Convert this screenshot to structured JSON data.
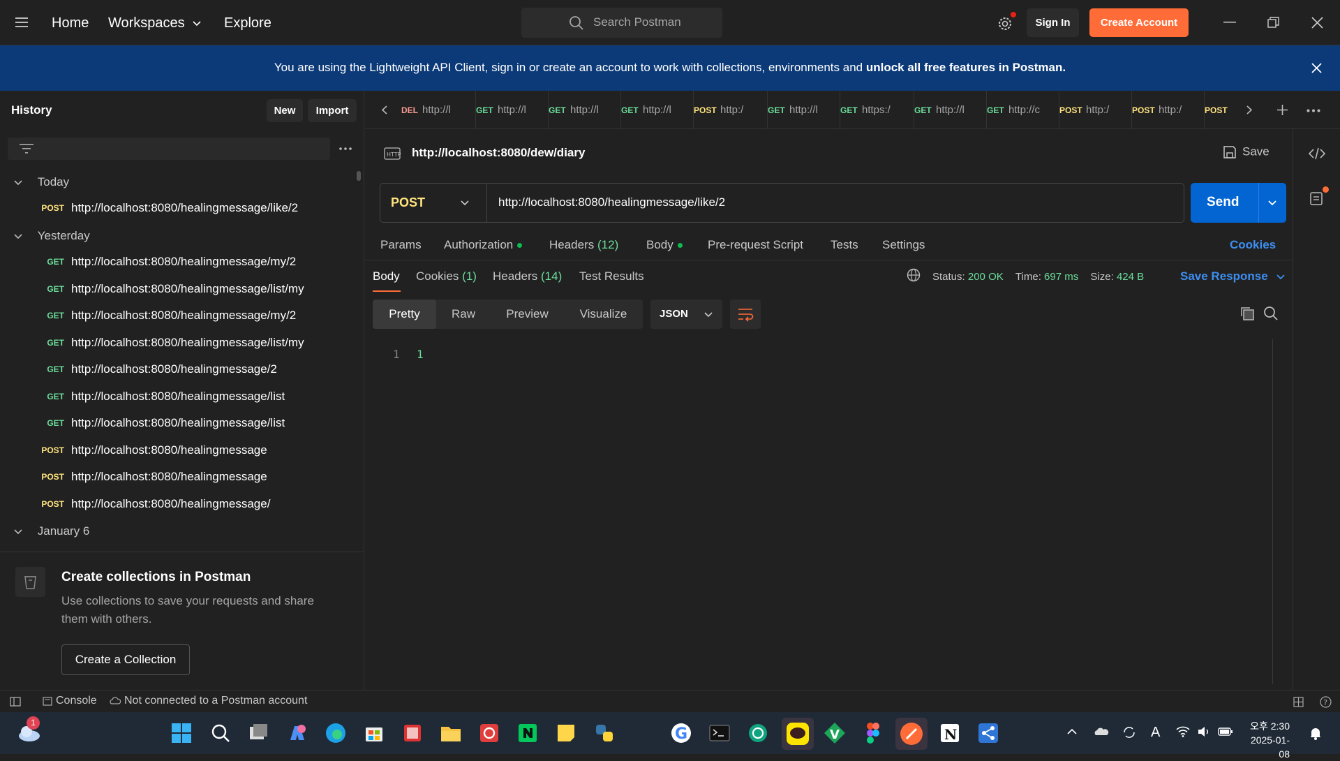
{
  "topbar": {
    "home": "Home",
    "workspaces": "Workspaces",
    "explore": "Explore",
    "search_placeholder": "Search Postman",
    "sign_in": "Sign In",
    "create_account": "Create Account"
  },
  "banner": {
    "text": "You are using the Lightweight API Client, sign in or create an account to work with collections, environments and ",
    "bold": "unlock all free features in Postman."
  },
  "sidebar": {
    "title": "History",
    "new_label": "New",
    "import_label": "Import",
    "groups": [
      {
        "label": "Today"
      },
      {
        "label": "Yesterday"
      },
      {
        "label": "January 6"
      }
    ],
    "items": [
      {
        "method": "POST",
        "url": "http://localhost:8080/healingmessage/like/2"
      },
      {
        "method": "GET",
        "url": "http://localhost:8080/healingmessage/my/2"
      },
      {
        "method": "GET",
        "url": "http://localhost:8080/healingmessage/list/my"
      },
      {
        "method": "GET",
        "url": "http://localhost:8080/healingmessage/my/2"
      },
      {
        "method": "GET",
        "url": "http://localhost:8080/healingmessage/list/my"
      },
      {
        "method": "GET",
        "url": "http://localhost:8080/healingmessage/2"
      },
      {
        "method": "GET",
        "url": "http://localhost:8080/healingmessage/list"
      },
      {
        "method": "GET",
        "url": "http://localhost:8080/healingmessage/list"
      },
      {
        "method": "POST",
        "url": "http://localhost:8080/healingmessage"
      },
      {
        "method": "POST",
        "url": "http://localhost:8080/healingmessage"
      },
      {
        "method": "POST",
        "url": "http://localhost:8080/healingmessage/"
      }
    ],
    "promo_title": "Create collections in Postman",
    "promo_text_1": "Use collections to save your requests and share",
    "promo_text_2": "them with others.",
    "promo_button": "Create a Collection"
  },
  "tabs": [
    {
      "method": "DEL",
      "url": "http://l"
    },
    {
      "method": "GET",
      "url": "http://l"
    },
    {
      "method": "GET",
      "url": "http://l"
    },
    {
      "method": "GET",
      "url": "http://l"
    },
    {
      "method": "POST",
      "url": "http:/"
    },
    {
      "method": "GET",
      "url": "http://l"
    },
    {
      "method": "GET",
      "url": "https:/"
    },
    {
      "method": "GET",
      "url": "http://l"
    },
    {
      "method": "GET",
      "url": "http://c"
    },
    {
      "method": "POST",
      "url": "http:/"
    },
    {
      "method": "POST",
      "url": "http:/"
    },
    {
      "method": "POST",
      "url": ""
    }
  ],
  "request": {
    "name": "http://localhost:8080/dew/diary",
    "save_label": "Save",
    "method": "POST",
    "url": "http://localhost:8080/healingmessage/like/2",
    "send_label": "Send",
    "tabs": {
      "params": "Params",
      "authorization": "Authorization",
      "headers": "Headers",
      "headers_count": "(12)",
      "body": "Body",
      "prerequest": "Pre-request Script",
      "tests": "Tests",
      "settings": "Settings",
      "cookies": "Cookies"
    }
  },
  "response": {
    "tabs": {
      "body": "Body",
      "cookies": "Cookies",
      "cookies_count": "(1)",
      "headers": "Headers",
      "headers_count": "(14)",
      "test_results": "Test Results"
    },
    "status_label": "Status:",
    "status_value": "200 OK",
    "time_label": "Time:",
    "time_value": "697 ms",
    "size_label": "Size:",
    "size_value": "424 B",
    "save_response": "Save Response",
    "view_modes": [
      "Pretty",
      "Raw",
      "Preview",
      "Visualize"
    ],
    "format": "JSON",
    "line_number": "1",
    "line_content": "1"
  },
  "statusbar": {
    "console": "Console",
    "connection": "Not connected to a Postman account"
  },
  "taskbar": {
    "time": "오후 2:30",
    "date": "2025-01-08",
    "notification_count": "1",
    "ime": "A"
  },
  "colors": {
    "accent_orange": "#ff6c37",
    "send_blue": "#0265d2",
    "banner_blue": "#0c3a78",
    "get_green": "#6bdd9a",
    "post_yellow": "#ffe47e",
    "status_green": "#0cbb52"
  }
}
